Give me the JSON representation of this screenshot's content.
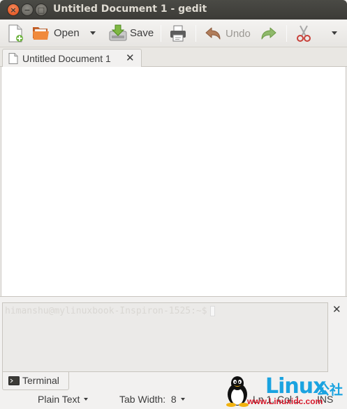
{
  "window": {
    "title": "Untitled Document 1 - gedit",
    "close_symbol": "×",
    "minimize_symbol": "−",
    "maximize_symbol": "□"
  },
  "toolbar": {
    "new_icon": "new-document-icon",
    "open_label": "Open",
    "save_label": "Save",
    "print_icon": "print-icon",
    "undo_label": "Undo",
    "redo_icon": "redo-icon",
    "cut_icon": "scissors-icon"
  },
  "tabs": [
    {
      "label": "Untitled Document 1",
      "close_symbol": "✕"
    }
  ],
  "editor": {
    "content": ""
  },
  "bottom_panel": {
    "terminal_prompt": "himanshu@mylinuxbook-Inspiron-1525:~$",
    "close_symbol": "✕",
    "tab_label": "Terminal"
  },
  "statusbar": {
    "language": "Plain Text",
    "tab_width": "Tab Width:  8",
    "position": "Ln 1, Col 1",
    "mode": "INS"
  },
  "watermark": {
    "brand": "Linux",
    "suffix": "公社",
    "url": "www.Linuxidc.com"
  },
  "colors": {
    "titlebar": "#3c3b37",
    "close_button": "#df4a16",
    "watermark_blue": "#1aa3e0",
    "watermark_red": "#d8182b"
  }
}
